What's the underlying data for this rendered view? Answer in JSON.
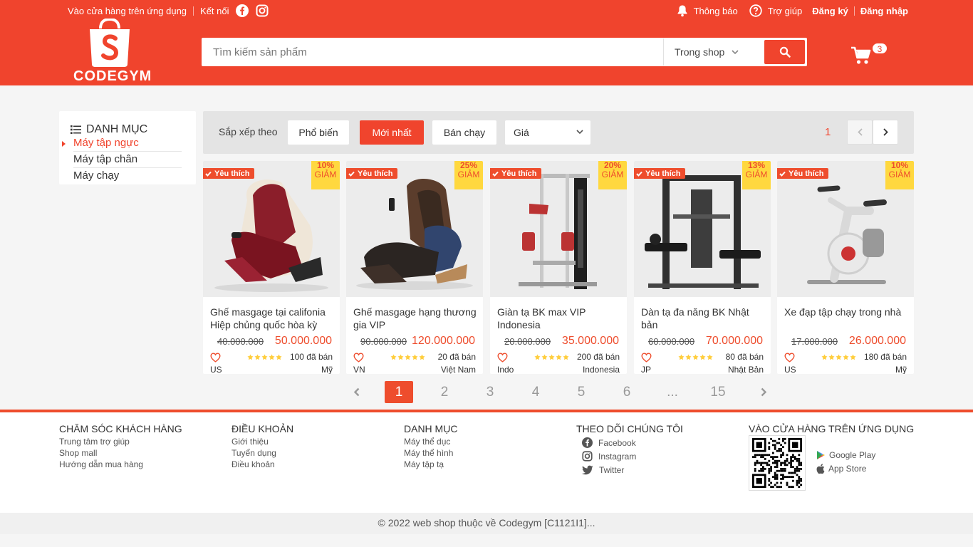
{
  "header": {
    "top_left": {
      "store_app": "Vào cửa hàng trên ứng dụng",
      "connect": "Kết nối",
      "facebook_icon": "facebook-icon",
      "instagram_icon": "instagram-icon"
    },
    "top_right": {
      "notifications": "Thông báo",
      "help": "Trợ giúp",
      "register": "Đăng ký",
      "login": "Đăng nhập"
    },
    "logo_text": "CODEGYM",
    "search": {
      "placeholder": "Tìm kiếm sản phẩm",
      "scope": "Trong shop",
      "button_icon": "search-icon"
    },
    "cart": {
      "count": "3",
      "icon": "cart-icon"
    }
  },
  "category": {
    "title": "DANH MỤC",
    "items": [
      {
        "label": "Máy tập ngực",
        "active": true
      },
      {
        "label": "Máy tập chân",
        "active": false
      },
      {
        "label": "Máy chạy",
        "active": false
      }
    ]
  },
  "sort": {
    "label": "Sắp xếp theo",
    "options": [
      "Phổ biến",
      "Mới nhất",
      "Bán chạy"
    ],
    "active": "Mới nhất",
    "price_select": "Giá",
    "current_page": "1"
  },
  "products": [
    {
      "favorite": "Yêu thích",
      "discount_pct": "10%",
      "discount_label": "GIẢM",
      "name": "Ghế masgage tại califonia Hiệp chủng quốc hòa kỳ",
      "old_price": "40.000.000",
      "new_price": "50.000.000",
      "rating": 5,
      "sold": "100 đã bán",
      "origin": "US",
      "country": "Mỹ"
    },
    {
      "favorite": "Yêu thích",
      "discount_pct": "25%",
      "discount_label": "GIẢM",
      "name": "Ghế masgage hạng thương gia VIP",
      "old_price": "90.000.000",
      "new_price": "120.000.000",
      "rating": 5,
      "sold": "20 đã bán",
      "origin": "VN",
      "country": "Việt Nam"
    },
    {
      "favorite": "Yêu thích",
      "discount_pct": "20%",
      "discount_label": "GIẢM",
      "name": "Giàn tạ BK max VIP Indonesia",
      "old_price": "20.000.000",
      "new_price": "35.000.000",
      "rating": 5,
      "sold": "200 đã bán",
      "origin": "Indo",
      "country": "Indonesia"
    },
    {
      "favorite": "Yêu thích",
      "discount_pct": "13%",
      "discount_label": "GIẢM",
      "name": "Dàn tạ đa năng BK Nhật bản",
      "old_price": "60.000.000",
      "new_price": "70.000.000",
      "rating": 5,
      "sold": "80 đã bán",
      "origin": "JP",
      "country": "Nhật Bản"
    },
    {
      "favorite": "Yêu thích",
      "discount_pct": "10%",
      "discount_label": "GIẢM",
      "name": "Xe đạp tập chạy trong nhà",
      "old_price": "17.000.000",
      "new_price": "26.000.000",
      "rating": 5,
      "sold": "180 đã bán",
      "origin": "US",
      "country": "Mỹ"
    }
  ],
  "pagination": {
    "pages": [
      "1",
      "2",
      "3",
      "4",
      "5",
      "6",
      "...",
      "15"
    ],
    "active": "1"
  },
  "footer": {
    "customer_care": {
      "title": "CHĂM SÓC KHÁCH HÀNG",
      "links": [
        "Trung tâm trợ giúp",
        "Shop mall",
        "Hướng dẫn mua hàng"
      ]
    },
    "terms": {
      "title": "ĐIỀU KHOẢN",
      "links": [
        "Giới thiệu",
        "Tuyển dụng",
        "Điều khoản"
      ]
    },
    "categories": {
      "title": "DANH MỤC",
      "links": [
        "Máy thể dục",
        "Máy thể hình",
        "Máy tập tạ"
      ]
    },
    "follow": {
      "title": "THEO DÕI CHÚNG TÔI",
      "links": [
        "Facebook",
        "Instagram",
        "Twitter"
      ]
    },
    "app": {
      "title": "VÀO CỬA HÀNG TRÊN ỨNG DỤNG",
      "google_play": "Google Play",
      "app_store": "App Store"
    },
    "copyright": "© 2022 web shop thuộc về Codegym [C1121I1]..."
  },
  "colors": {
    "primary": "#f0442d",
    "accent": "#ee4d2d",
    "badge": "#ffd83f"
  }
}
